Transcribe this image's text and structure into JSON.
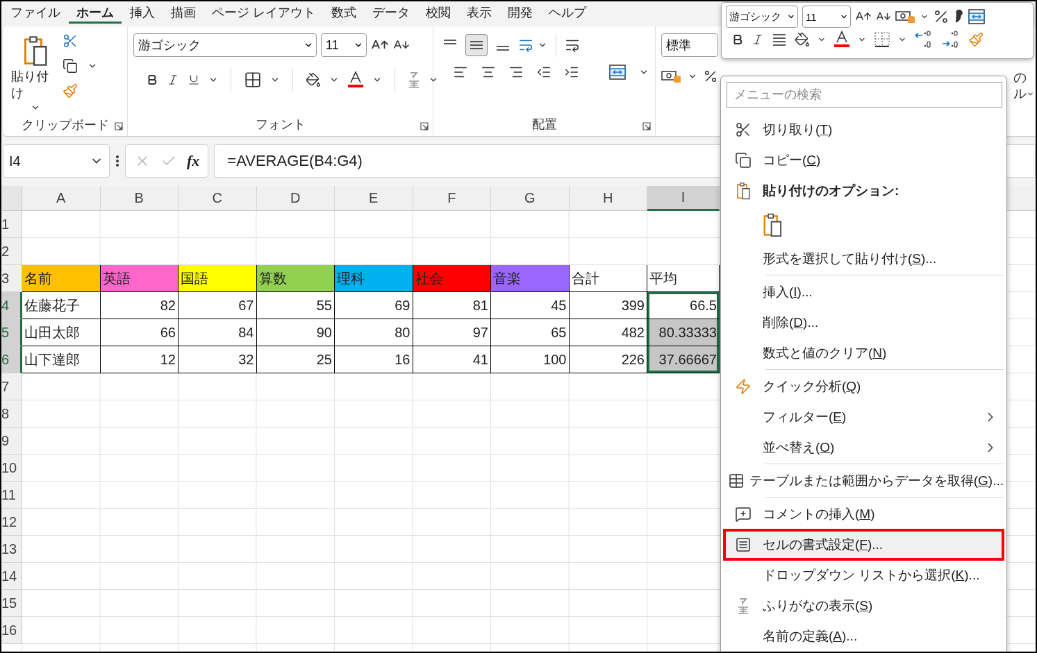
{
  "ribbon": {
    "tabs": [
      {
        "label": "ファイル",
        "selected": false
      },
      {
        "label": "ホーム",
        "selected": true
      },
      {
        "label": "挿入",
        "selected": false
      },
      {
        "label": "描画",
        "selected": false
      },
      {
        "label": "ページ レイアウト",
        "selected": false
      },
      {
        "label": "数式",
        "selected": false
      },
      {
        "label": "データ",
        "selected": false
      },
      {
        "label": "校閲",
        "selected": false
      },
      {
        "label": "表示",
        "selected": false
      },
      {
        "label": "開発",
        "selected": false
      },
      {
        "label": "ヘルプ",
        "selected": false
      }
    ],
    "clipboard": {
      "paste_label": "貼り付け",
      "group_label": "クリップボード"
    },
    "font": {
      "font_name": "游ゴシック",
      "font_size": "11",
      "group_label": "フォント"
    },
    "alignment": {
      "group_label": "配置",
      "vertical_align": [
        {
          "selected": false
        },
        {
          "selected": true
        },
        {
          "selected": false
        }
      ]
    },
    "number": {
      "format": "標準"
    },
    "styles_fragment": [
      "の",
      "ル"
    ]
  },
  "formula_bar": {
    "name_box": "I4",
    "function_label": "fx",
    "formula": "=AVERAGE(B4:G4)"
  },
  "grid": {
    "columns": [
      {
        "label": "A",
        "selected": false
      },
      {
        "label": "B",
        "selected": false
      },
      {
        "label": "C",
        "selected": false
      },
      {
        "label": "D",
        "selected": false
      },
      {
        "label": "E",
        "selected": false
      },
      {
        "label": "F",
        "selected": false
      },
      {
        "label": "G",
        "selected": false
      },
      {
        "label": "H",
        "selected": false
      },
      {
        "label": "I",
        "selected": true
      }
    ],
    "rows": [
      {
        "number": "1",
        "selected": false,
        "cells": []
      },
      {
        "number": "2",
        "selected": false,
        "cells": []
      },
      {
        "number": "3",
        "selected": false,
        "cells": [
          {
            "text": "名前",
            "kind": "text",
            "color": "#ffc000",
            "selected": false,
            "active": false
          },
          {
            "text": "英語",
            "kind": "text",
            "color": "#ff66cc",
            "selected": false,
            "active": false
          },
          {
            "text": "国語",
            "kind": "text",
            "color": "#ffff00",
            "selected": false,
            "active": false
          },
          {
            "text": "算数",
            "kind": "text",
            "color": "#92d050",
            "selected": false,
            "active": false
          },
          {
            "text": "理科",
            "kind": "text",
            "color": "#00b0f0",
            "selected": false,
            "active": false
          },
          {
            "text": "社会",
            "kind": "text",
            "color": "#ff0000",
            "selected": false,
            "active": false
          },
          {
            "text": "音楽",
            "kind": "text",
            "color": "#9966ff",
            "selected": false,
            "active": false
          },
          {
            "text": "合計",
            "kind": "text",
            "color": "#ffffff",
            "selected": false,
            "active": false
          },
          {
            "text": "平均",
            "kind": "text",
            "color": "#ffffff",
            "selected": false,
            "active": false
          }
        ]
      },
      {
        "number": "4",
        "selected": true,
        "cells": [
          {
            "text": "佐藤花子",
            "kind": "text",
            "selected": false,
            "active": false
          },
          {
            "text": "82",
            "kind": "number",
            "selected": false,
            "active": false
          },
          {
            "text": "67",
            "kind": "number",
            "selected": false,
            "active": false
          },
          {
            "text": "55",
            "kind": "number",
            "selected": false,
            "active": false
          },
          {
            "text": "69",
            "kind": "number",
            "selected": false,
            "active": false
          },
          {
            "text": "81",
            "kind": "number",
            "selected": false,
            "active": false
          },
          {
            "text": "45",
            "kind": "number",
            "selected": false,
            "active": false
          },
          {
            "text": "399",
            "kind": "number",
            "selected": false,
            "active": false
          },
          {
            "text": "66.5",
            "kind": "number",
            "selected": true,
            "active": true
          }
        ]
      },
      {
        "number": "5",
        "selected": true,
        "cells": [
          {
            "text": "山田太郎",
            "kind": "text",
            "selected": false,
            "active": false
          },
          {
            "text": "66",
            "kind": "number",
            "selected": false,
            "active": false
          },
          {
            "text": "84",
            "kind": "number",
            "selected": false,
            "active": false
          },
          {
            "text": "90",
            "kind": "number",
            "selected": false,
            "active": false
          },
          {
            "text": "80",
            "kind": "number",
            "selected": false,
            "active": false
          },
          {
            "text": "97",
            "kind": "number",
            "selected": false,
            "active": false
          },
          {
            "text": "65",
            "kind": "number",
            "selected": false,
            "active": false
          },
          {
            "text": "482",
            "kind": "number",
            "selected": false,
            "active": false
          },
          {
            "text": "80.33333",
            "kind": "number",
            "selected": true,
            "active": false
          }
        ]
      },
      {
        "number": "6",
        "selected": true,
        "cells": [
          {
            "text": "山下達郎",
            "kind": "text",
            "selected": false,
            "active": false
          },
          {
            "text": "12",
            "kind": "number",
            "selected": false,
            "active": false
          },
          {
            "text": "32",
            "kind": "number",
            "selected": false,
            "active": false
          },
          {
            "text": "25",
            "kind": "number",
            "selected": false,
            "active": false
          },
          {
            "text": "16",
            "kind": "number",
            "selected": false,
            "active": false
          },
          {
            "text": "41",
            "kind": "number",
            "selected": false,
            "active": false
          },
          {
            "text": "100",
            "kind": "number",
            "selected": false,
            "active": false
          },
          {
            "text": "226",
            "kind": "number",
            "selected": false,
            "active": false
          },
          {
            "text": "37.66667",
            "kind": "number",
            "selected": true,
            "active": false
          }
        ]
      },
      {
        "number": "7",
        "selected": false,
        "cells": []
      },
      {
        "number": "8",
        "selected": false,
        "cells": []
      },
      {
        "number": "9",
        "selected": false,
        "cells": []
      },
      {
        "number": "10",
        "selected": false,
        "cells": []
      },
      {
        "number": "11",
        "selected": false,
        "cells": []
      },
      {
        "number": "12",
        "selected": false,
        "cells": []
      },
      {
        "number": "13",
        "selected": false,
        "cells": []
      },
      {
        "number": "14",
        "selected": false,
        "cells": []
      },
      {
        "number": "15",
        "selected": false,
        "cells": []
      },
      {
        "number": "16",
        "selected": false,
        "cells": []
      }
    ]
  },
  "mini_toolbar": {
    "font_name": "游ゴシック",
    "font_size": "11"
  },
  "context_menu": {
    "search_placeholder": "メニューの検索",
    "items": [
      {
        "kind": "command",
        "label": "切り取り(T)",
        "mnemonic": true,
        "submenu": false,
        "selected": false
      },
      {
        "kind": "command",
        "label": "コピー(C)",
        "mnemonic": true,
        "submenu": false,
        "selected": false
      },
      {
        "kind": "header",
        "label": "貼り付けのオプション:"
      },
      {
        "kind": "paste_button"
      },
      {
        "kind": "command",
        "label": "形式を選択して貼り付け(S)...",
        "mnemonic": true,
        "submenu": false,
        "selected": false
      },
      {
        "kind": "separator"
      },
      {
        "kind": "command",
        "label": "挿入(I)...",
        "mnemonic": true,
        "submenu": false,
        "selected": false
      },
      {
        "kind": "command",
        "label": "削除(D)...",
        "mnemonic": true,
        "submenu": false,
        "selected": false
      },
      {
        "kind": "command",
        "label": "数式と値のクリア(N)",
        "mnemonic": true,
        "submenu": false,
        "selected": false
      },
      {
        "kind": "separator"
      },
      {
        "kind": "command",
        "label": "クイック分析(Q)",
        "mnemonic": true,
        "submenu": false,
        "selected": false
      },
      {
        "kind": "command",
        "label": "フィルター(E)",
        "mnemonic": true,
        "submenu": true,
        "selected": false
      },
      {
        "kind": "command",
        "label": "並べ替え(O)",
        "mnemonic": true,
        "submenu": true,
        "selected": false
      },
      {
        "kind": "separator"
      },
      {
        "kind": "command",
        "label": "テーブルまたは範囲からデータを取得(G)...",
        "mnemonic": true,
        "submenu": false,
        "selected": false
      },
      {
        "kind": "separator"
      },
      {
        "kind": "command",
        "label": "コメントの挿入(M)",
        "mnemonic": true,
        "submenu": false,
        "selected": false
      },
      {
        "kind": "command",
        "label": "セルの書式設定(F)...",
        "mnemonic": true,
        "submenu": false,
        "selected": true
      },
      {
        "kind": "command",
        "label": "ドロップダウン リストから選択(K)...",
        "mnemonic": true,
        "submenu": false,
        "selected": false
      },
      {
        "kind": "command",
        "label": "ふりがなの表示(S)",
        "mnemonic": true,
        "submenu": false,
        "selected": false
      },
      {
        "kind": "command",
        "label": "名前の定義(A)...",
        "mnemonic": true,
        "submenu": false,
        "selected": false
      }
    ]
  }
}
